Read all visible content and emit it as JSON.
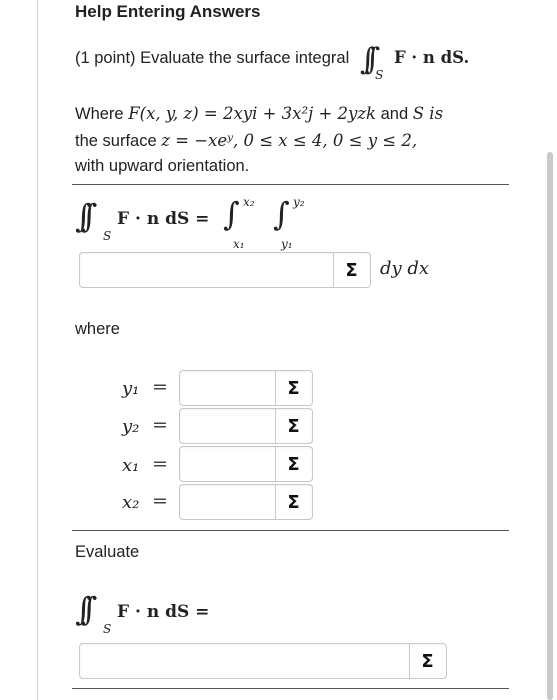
{
  "title": "Help Entering Answers",
  "problem": {
    "points": "(1 point) Evaluate the surface integral",
    "integrand": "F · n dS.",
    "where_intro": "Where",
    "field_def": "F(x, y, z) = 2xyi + 3x²j + 2yzk",
    "and_s": "and",
    "s_is": "S is",
    "surface_the": "the surface",
    "surface_def": "z = −xeʸ, 0 ≤ x ≤ 4,  0 ≤ y ≤ 2,",
    "orientation": "with upward orientation."
  },
  "setup": {
    "integrand": "F · n dS =",
    "upper_outer": "x₂",
    "lower_outer": "x₁",
    "upper_inner": "y₂",
    "lower_inner": "y₁",
    "differentials": "dy dx",
    "answer_value": "",
    "sigma_label": "Σ"
  },
  "where_label": "where",
  "limits": [
    {
      "var": "y₁",
      "value": ""
    },
    {
      "var": "y₂",
      "value": ""
    },
    {
      "var": "x₁",
      "value": ""
    },
    {
      "var": "x₂",
      "value": ""
    }
  ],
  "evaluate": {
    "label": "Evaluate",
    "integrand": "F · n dS =",
    "answer_value": ""
  },
  "colors": {
    "rule": "#555555",
    "box_border": "#c8c8c8",
    "scrollbar": "#c9c9c9"
  }
}
